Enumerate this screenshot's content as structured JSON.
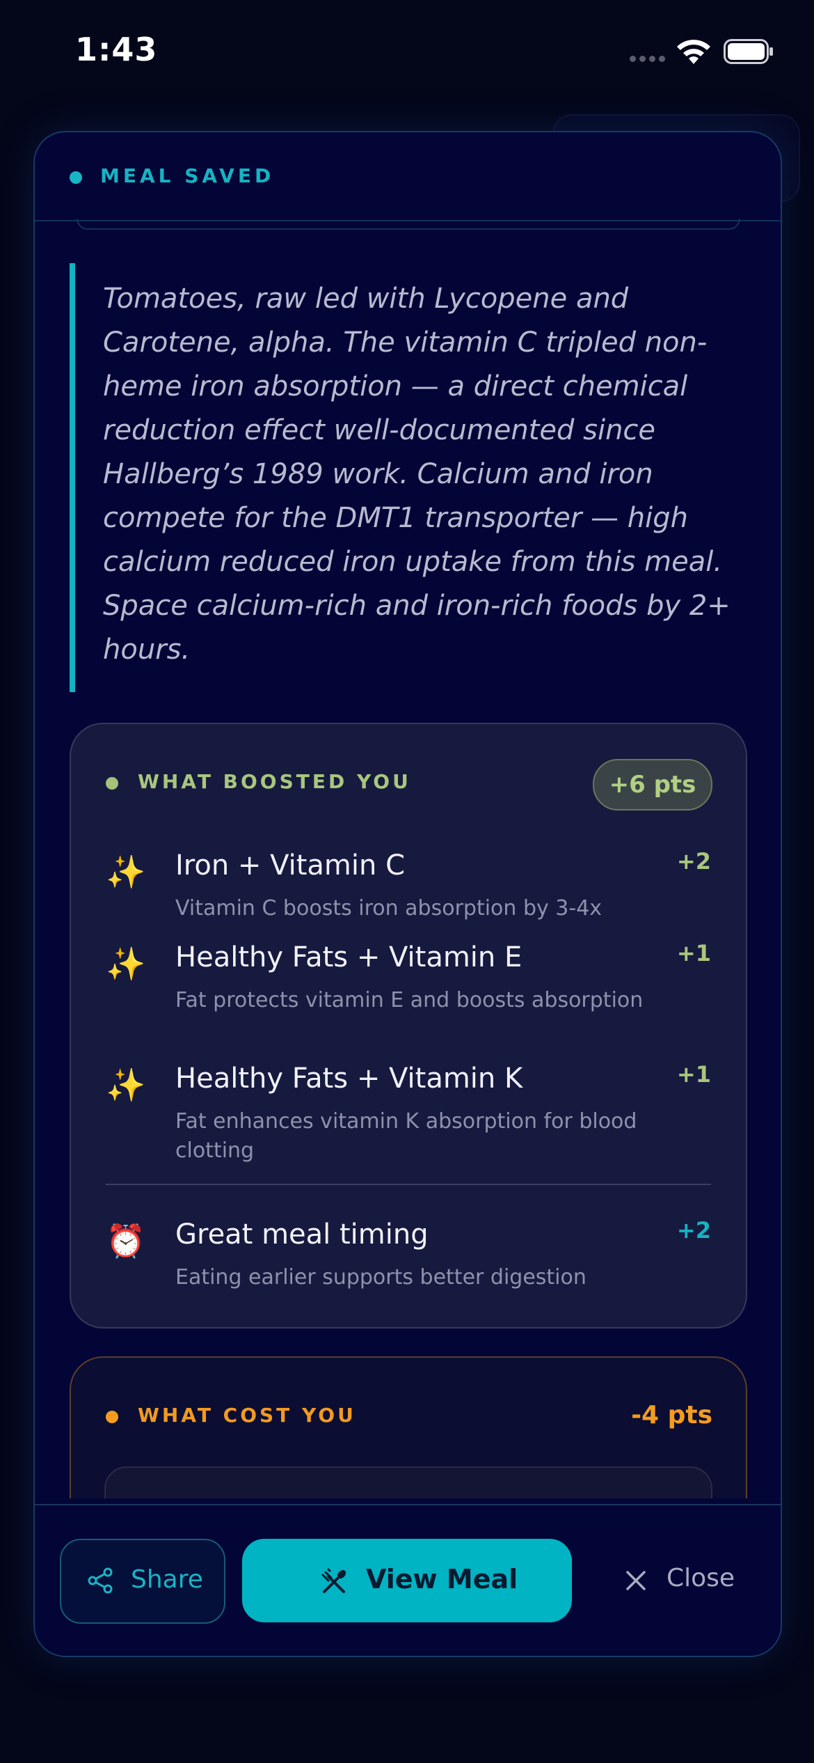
{
  "status_bar": {
    "time": "1:43"
  },
  "modal": {
    "header_title": "MEAL SAVED",
    "explanation": "Tomatoes, raw led with Lycopene and Carotene, alpha. The vitamin C tripled non-heme iron absorption — a direct chemical reduction effect well-documented since Hallberg’s 1989 work. Calcium and iron compete for the DMT1 transporter — high calcium reduced iron uptake from this meal. Space calcium-rich and iron-rich foods by 2+ hours.",
    "boosted": {
      "label": "WHAT BOOSTED YOU",
      "total": "+6 pts",
      "items": [
        {
          "icon": "sparkles-icon",
          "title": "Iron + Vitamin C",
          "desc": "Vitamin C boosts iron absorption by 3-4x",
          "pts": "+2",
          "color": "#a9c67d"
        },
        {
          "icon": "sparkles-icon",
          "title": "Healthy Fats + Vitamin E",
          "desc": "Fat protects vitamin E and boosts absorption",
          "pts": "+1",
          "color": "#a9c67d"
        },
        {
          "icon": "sparkles-icon",
          "title": "Healthy Fats + Vitamin K",
          "desc": "Fat enhances vitamin K absorption for blood clotting",
          "pts": "+1",
          "color": "#a9c67d"
        }
      ],
      "timing": {
        "icon": "alarm-clock-icon",
        "title": "Great meal timing",
        "desc": "Eating earlier supports better digestion",
        "pts": "+2",
        "color": "#16b3c3"
      }
    },
    "cost": {
      "label": "WHAT COST YOU",
      "total": "-4 pts"
    }
  },
  "footer": {
    "share_label": "Share",
    "view_label": "View Meal",
    "close_label": "Close"
  },
  "colors": {
    "accent": "#00b4c3",
    "boost": "#a9c67d",
    "cost": "#f29a1f",
    "background": "#030536"
  }
}
